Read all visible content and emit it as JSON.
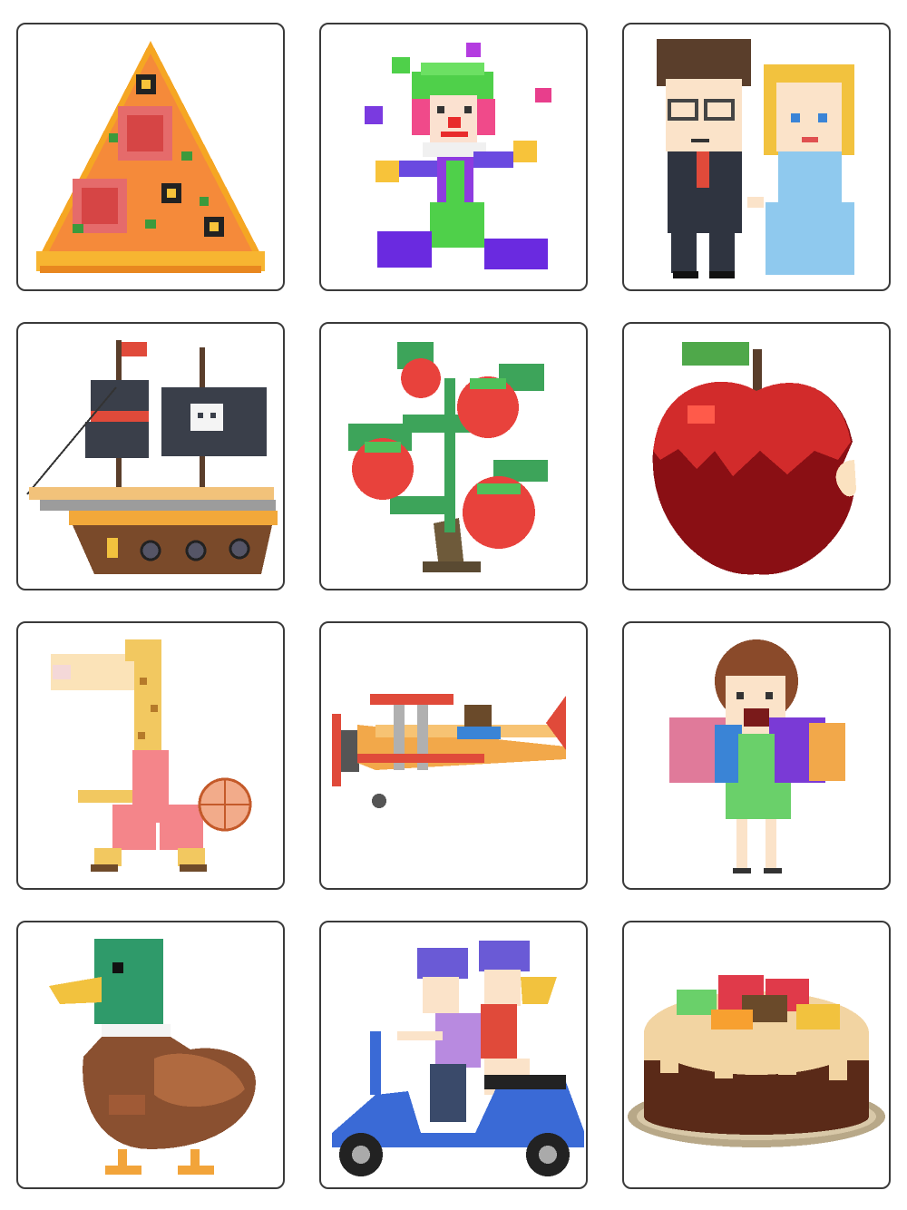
{
  "gallery": {
    "items": [
      {
        "icon": "pizza-slice-icon"
      },
      {
        "icon": "juggling-clown-icon"
      },
      {
        "icon": "couple-icon"
      },
      {
        "icon": "pirate-ship-icon"
      },
      {
        "icon": "tomato-plant-icon"
      },
      {
        "icon": "bitten-apple-icon"
      },
      {
        "icon": "giraffe-basketball-icon"
      },
      {
        "icon": "biplane-icon"
      },
      {
        "icon": "shopping-woman-icon"
      },
      {
        "icon": "mallard-duck-icon"
      },
      {
        "icon": "scooter-riders-icon"
      },
      {
        "icon": "cake-icon"
      }
    ]
  },
  "colors": {
    "card_border": "#3a3a3a",
    "background": "#ffffff"
  }
}
